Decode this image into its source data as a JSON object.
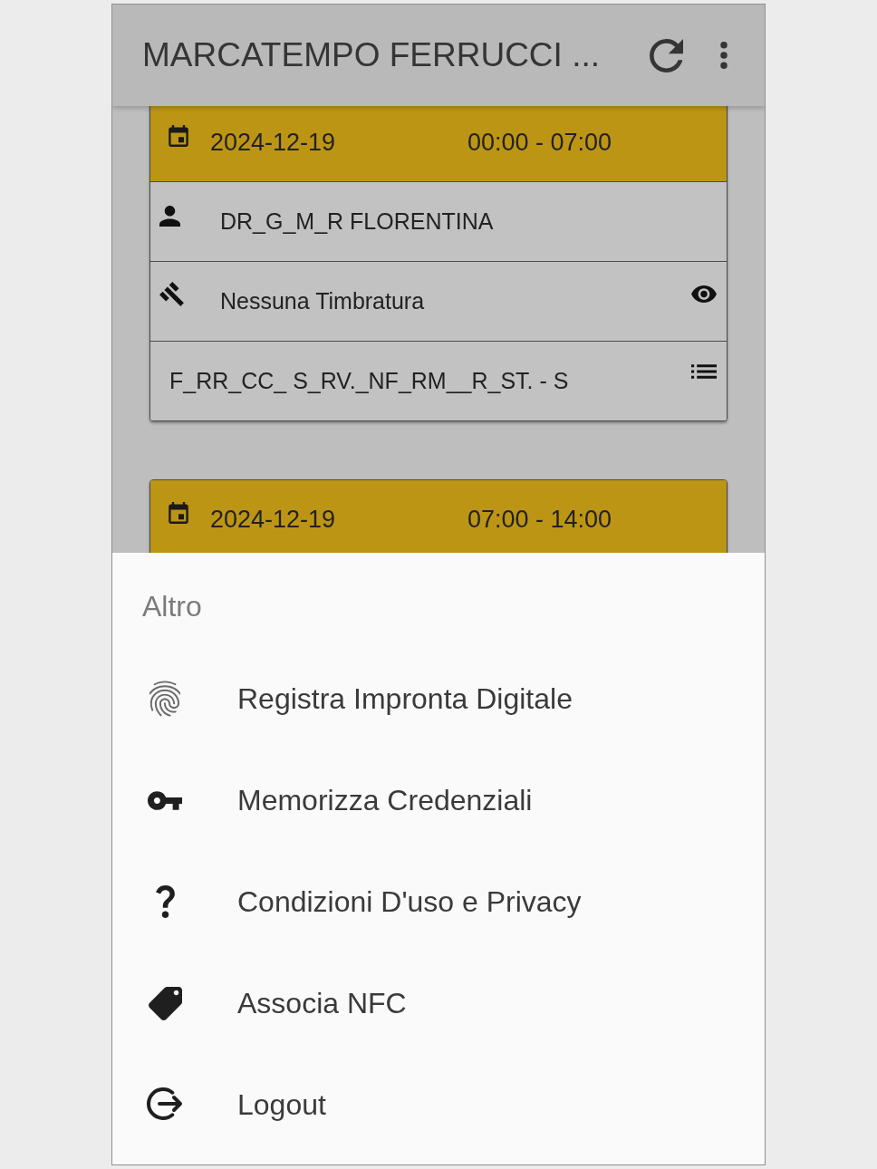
{
  "app_bar": {
    "title": "MARCATEMPO FERRUCCI ..."
  },
  "shifts": [
    {
      "date": "2024-12-19",
      "time": "00:00 - 07:00",
      "rows": [
        {
          "kind": "employee",
          "text": "DR_G_M_R FLORENTINA"
        },
        {
          "kind": "clockings",
          "text": "Nessuna Timbratura"
        },
        {
          "kind": "site",
          "text": "F_RR_CC_ S_RV._NF_RM__R_ST. - S"
        }
      ]
    },
    {
      "date": "2024-12-19",
      "time": "07:00 - 14:00"
    }
  ],
  "bottom_sheet": {
    "heading": "Altro",
    "items": [
      {
        "kind": "fingerprint",
        "label": "Registra Impronta Digitale"
      },
      {
        "kind": "credentials",
        "label": "Memorizza Credenziali"
      },
      {
        "kind": "terms",
        "label": "Condizioni D'uso e Privacy"
      },
      {
        "kind": "nfc",
        "label": "Associa NFC"
      },
      {
        "kind": "logout",
        "label": "Logout"
      }
    ]
  }
}
